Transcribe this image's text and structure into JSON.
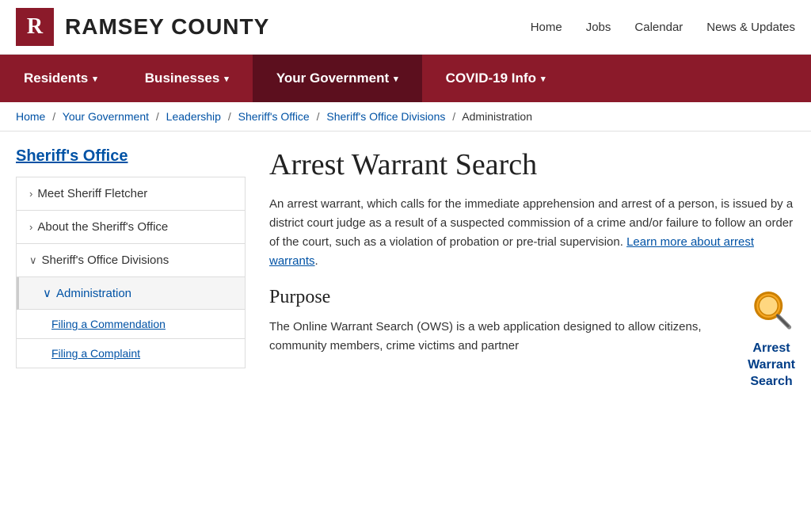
{
  "header": {
    "logo_letter": "R",
    "site_name": "RAMSEY COUNTY",
    "top_nav": [
      {
        "label": "Home",
        "url": "#"
      },
      {
        "label": "Jobs",
        "url": "#"
      },
      {
        "label": "Calendar",
        "url": "#"
      },
      {
        "label": "News & Updates",
        "url": "#"
      }
    ]
  },
  "main_nav": [
    {
      "label": "Residents",
      "active": false,
      "has_dropdown": true
    },
    {
      "label": "Businesses",
      "active": false,
      "has_dropdown": true
    },
    {
      "label": "Your Government",
      "active": true,
      "has_dropdown": true
    },
    {
      "label": "COVID-19 Info",
      "active": false,
      "has_dropdown": true
    }
  ],
  "breadcrumb": {
    "items": [
      {
        "label": "Home",
        "url": "#"
      },
      {
        "label": "Your Government",
        "url": "#"
      },
      {
        "label": "Leadership",
        "url": "#"
      },
      {
        "label": "Sheriff's Office",
        "url": "#"
      },
      {
        "label": "Sheriff's Office Divisions",
        "url": "#"
      },
      {
        "label": "Administration",
        "url": null
      }
    ]
  },
  "sidebar": {
    "title": "Sheriff's Office",
    "items": [
      {
        "label": "Meet Sheriff Fletcher",
        "arrow": "›",
        "expanded": false,
        "sub_items": []
      },
      {
        "label": "About the Sheriff's Office",
        "arrow": "›",
        "expanded": false,
        "sub_items": []
      },
      {
        "label": "Sheriff's Office Divisions",
        "arrow": "∨",
        "expanded": true,
        "sub_items": [
          {
            "label": "Administration",
            "arrow": "∨",
            "selected": true,
            "sub_sub_items": [
              {
                "label": "Filing a Commendation"
              },
              {
                "label": "Filing a Complaint"
              }
            ]
          }
        ]
      }
    ]
  },
  "main_content": {
    "title": "Arrest Warrant Search",
    "intro": "An arrest warrant, which calls for the immediate apprehension and arrest of a person, is issued by a district court judge as a result of a suspected commission of a crime and/or failure to follow an order of the court, such as a violation of probation or pre-trial supervision.",
    "learn_more_link": "Learn more about arrest warrants",
    "section_title": "Purpose",
    "section_body": "The Online Warrant Search (OWS) is a web application designed to allow citizens, community members, crime victims and partner",
    "warrant_widget": {
      "label_line1": "Arrest",
      "label_line2": "Warrant",
      "label_line3": "Search"
    }
  }
}
